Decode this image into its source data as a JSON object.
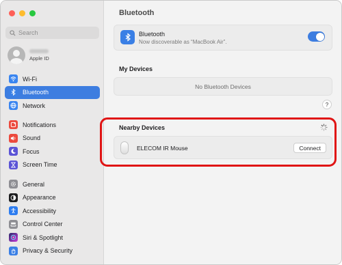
{
  "window": {
    "traffic_lights": [
      "#fe5f57",
      "#febc2e",
      "#28c840"
    ]
  },
  "sidebar": {
    "search_placeholder": "Search",
    "account": {
      "subtitle": "Apple ID"
    },
    "groups": [
      [
        {
          "label": "Wi-Fi",
          "icon": "wifi-icon",
          "color": "#3a85f0",
          "active": false
        },
        {
          "label": "Bluetooth",
          "icon": "bluetooth-icon",
          "color": "#3a7fe5",
          "active": true
        },
        {
          "label": "Network",
          "icon": "globe-icon",
          "color": "#3a85f0",
          "active": false
        }
      ],
      [
        {
          "label": "Notifications",
          "icon": "bell-icon",
          "color": "#ec4a3e",
          "active": false
        },
        {
          "label": "Sound",
          "icon": "speaker-icon",
          "color": "#ec4a3e",
          "active": false
        },
        {
          "label": "Focus",
          "icon": "moon-icon",
          "color": "#5b54d6",
          "active": false
        },
        {
          "label": "Screen Time",
          "icon": "hourglass-icon",
          "color": "#5b54d6",
          "active": false
        }
      ],
      [
        {
          "label": "General",
          "icon": "gear-icon",
          "color": "#8e8e93",
          "active": false
        },
        {
          "label": "Appearance",
          "icon": "appearance-icon",
          "color": "#1d1d1f",
          "active": false
        },
        {
          "label": "Accessibility",
          "icon": "accessibility-icon",
          "color": "#2d7cf0",
          "active": false
        },
        {
          "label": "Control Center",
          "icon": "control-center-icon",
          "color": "#8e8e93",
          "active": false
        },
        {
          "label": "Siri & Spotlight",
          "icon": "siri-icon",
          "color": "#5a3fd1",
          "active": false
        },
        {
          "label": "Privacy & Security",
          "icon": "hand-icon",
          "color": "#3a7fe5",
          "active": false
        }
      ]
    ]
  },
  "main": {
    "title": "Bluetooth",
    "bluetooth": {
      "name": "Bluetooth",
      "status": "Now discoverable as “MacBook Air”.",
      "enabled": true
    },
    "my_devices": {
      "title": "My Devices",
      "empty_text": "No Bluetooth Devices"
    },
    "help_label": "?",
    "nearby": {
      "title": "Nearby Devices",
      "device_name": "ELECOM IR Mouse",
      "connect_label": "Connect"
    },
    "colors": {
      "accent": "#3d7de0",
      "highlight": "#e01414"
    }
  }
}
